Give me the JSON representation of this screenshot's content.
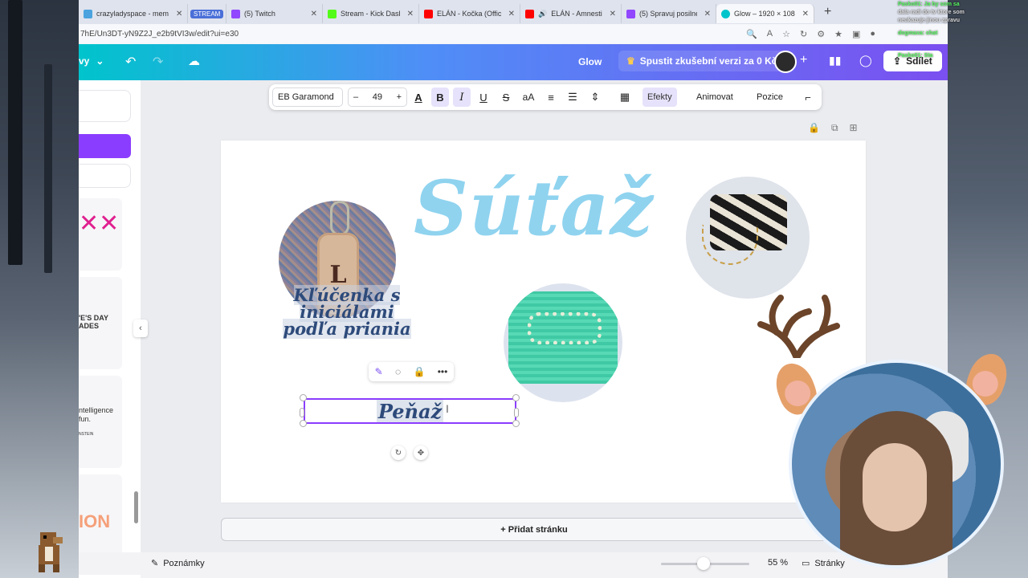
{
  "browser": {
    "tabs": [
      {
        "label": "crazyladyspace - mem",
        "color": "#4aa3df",
        "active": false
      },
      {
        "label": "STREAM",
        "color": "#4a6fd8",
        "active": false,
        "is_group": true
      },
      {
        "label": "(5) Twitch",
        "color": "#9146ff",
        "active": false
      },
      {
        "label": "Stream - Kick Dashboa",
        "color": "#53fc18",
        "active": false
      },
      {
        "label": "ELÁN - Kočka (Official",
        "color": "#ff0000",
        "active": false
      },
      {
        "label": "ELÁN - Amnestia",
        "color": "#ff0000",
        "active": false
      },
      {
        "label": "(5) Spravuj posilnenia",
        "color": "#9146ff",
        "active": false
      },
      {
        "label": "Glow – 1920 × 1080 px",
        "color": "#00c4cc",
        "active": true
      }
    ],
    "url": "7hE/Un3DT-yN9Z2J_e2b9tVI3w/edit?ui=e30"
  },
  "canva_header": {
    "project_name": "Glow",
    "trial_label": "Spustit zkušební verzi za 0 Kč",
    "share_label": "Sdílet",
    "menu_partial": "vy"
  },
  "text_toolbar": {
    "font": "EB Garamond",
    "size": "49",
    "effects": "Efekty",
    "animate": "Animovat",
    "position": "Pozice"
  },
  "sidepanel": {
    "thumb_texts": [
      "'E'S DAY",
      "ADES",
      "ntelligence",
      "fun.",
      "NSTEIN",
      "ION"
    ]
  },
  "canvas": {
    "title": "Súťaž",
    "keychain_caption_line1": "Kľúčenka s iniciálami",
    "keychain_caption_line2": "podľa priania",
    "keychain_letter": "L",
    "selected_text": "Peňaž"
  },
  "add_page_label": "+ Přidat stránku",
  "footer": {
    "notes_label": "Poznámky",
    "zoom_value": "55 %",
    "zoom_level": 0.55,
    "pages_label": "Stránky"
  },
  "stream_chat": [
    "Pasko01: Ja by som sa",
    "dala radi do tv ktore som",
    "neukazuje jinou zpravu",
    "dogmaxa: chat",
    "Pasko01: Sta"
  ]
}
